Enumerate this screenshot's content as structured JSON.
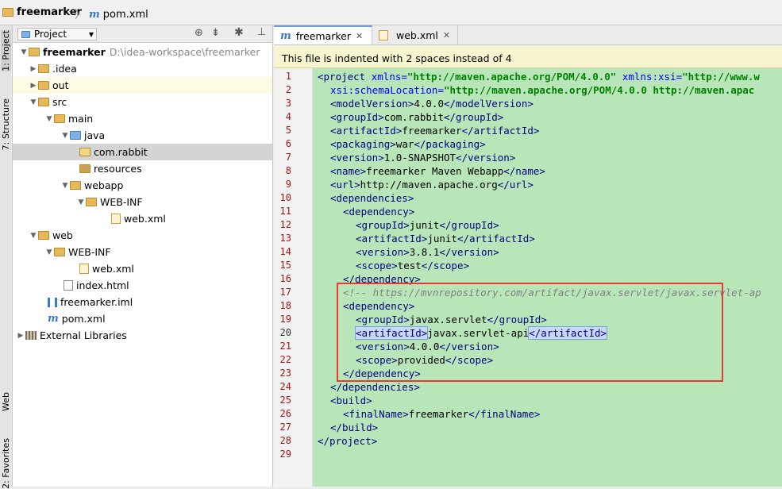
{
  "breadcrumb": {
    "project": "freemarker",
    "file": "pom.xml"
  },
  "toolstrip": {
    "project_tab": "1: Project",
    "structure_tab": "7: Structure",
    "web_tab": "Web",
    "favorites_tab": "2: Favorites"
  },
  "project_panel": {
    "view_label": "Project",
    "root_name": "freemarker",
    "root_path": "D:\\idea-workspace\\freemarker",
    "nodes": [
      {
        "label": ".idea"
      },
      {
        "label": "out"
      },
      {
        "label": "src"
      },
      {
        "label": "main"
      },
      {
        "label": "java"
      },
      {
        "label": "com.rabbit"
      },
      {
        "label": "resources"
      },
      {
        "label": "webapp"
      },
      {
        "label": "WEB-INF"
      },
      {
        "label": "web.xml"
      },
      {
        "label": "web"
      },
      {
        "label": "WEB-INF"
      },
      {
        "label": "web.xml"
      },
      {
        "label": "index.html"
      },
      {
        "label": "freemarker.iml"
      },
      {
        "label": "pom.xml"
      },
      {
        "label": "External Libraries"
      }
    ]
  },
  "tabs": [
    {
      "label": "freemarker"
    },
    {
      "label": "web.xml"
    }
  ],
  "notice": "This file is indented with 2 spaces instead of 4",
  "code": {
    "line_numbers": [
      "1",
      "2",
      "3",
      "4",
      "5",
      "6",
      "7",
      "8",
      "9",
      "10",
      "11",
      "12",
      "13",
      "14",
      "15",
      "16",
      "17",
      "18",
      "19",
      "20",
      "21",
      "22",
      "23",
      "24",
      "25",
      "26",
      "27",
      "28",
      "29"
    ],
    "l1_tag": "<project",
    "l1_attr1": " xmlns=",
    "l1_val1": "\"http://maven.apache.org/POM/4.0.0\"",
    "l1_attr2": " xmlns:xsi=",
    "l1_val2": "\"http://www.w",
    "l2_attr": "xsi:schemaLocation=",
    "l2_val": "\"http://maven.apache.org/POM/4.0.0 http://maven.apac",
    "l3_open": "<modelVersion>",
    "l3_text": "4.0.0",
    "l3_close": "</modelVersion>",
    "l4_open": "<groupId>",
    "l4_text": "com.rabbit",
    "l4_close": "</groupId>",
    "l5_open": "<artifactId>",
    "l5_text": "freemarker",
    "l5_close": "</artifactId>",
    "l6_open": "<packaging>",
    "l6_text": "war",
    "l6_close": "</packaging>",
    "l7_open": "<version>",
    "l7_text": "1.0-SNAPSHOT",
    "l7_close": "</version>",
    "l8_open": "<name>",
    "l8_text": "freemarker Maven Webapp",
    "l8_close": "</name>",
    "l9_open": "<url>",
    "l9_text": "http://maven.apache.org",
    "l9_close": "</url>",
    "l10": "<dependencies>",
    "l11": "<dependency>",
    "l12_open": "<groupId>",
    "l12_text": "junit",
    "l12_close": "</groupId>",
    "l13_open": "<artifactId>",
    "l13_text": "junit",
    "l13_close": "</artifactId>",
    "l14_open": "<version>",
    "l14_text": "3.8.1",
    "l14_close": "</version>",
    "l15_open": "<scope>",
    "l15_text": "test",
    "l15_close": "</scope>",
    "l16": "</dependency>",
    "l17": "<!-- https://mvnrepository.com/artifact/javax.servlet/javax.servlet-ap",
    "l18": "<dependency>",
    "l19_open": "<groupId>",
    "l19_text": "javax.servlet",
    "l19_close": "</groupId>",
    "l20_open": "<artifactId>",
    "l20_text": "javax.servlet-api",
    "l20_close": "</artifactId>",
    "l21_open": "<version>",
    "l21_text": "4.0.0",
    "l21_close": "</version>",
    "l22_open": "<scope>",
    "l22_text": "provided",
    "l22_close": "</scope>",
    "l23": "</dependency>",
    "l24": "</dependencies>",
    "l25": "<build>",
    "l26_open": "<finalName>",
    "l26_text": "freemarker",
    "l26_close": "</finalName>",
    "l27": "</build>",
    "l28": "</project>"
  },
  "colors": {
    "code_bg": "#b8e6b8",
    "highlight_box": "#e53935",
    "notice_bg": "#f6f5cf"
  }
}
